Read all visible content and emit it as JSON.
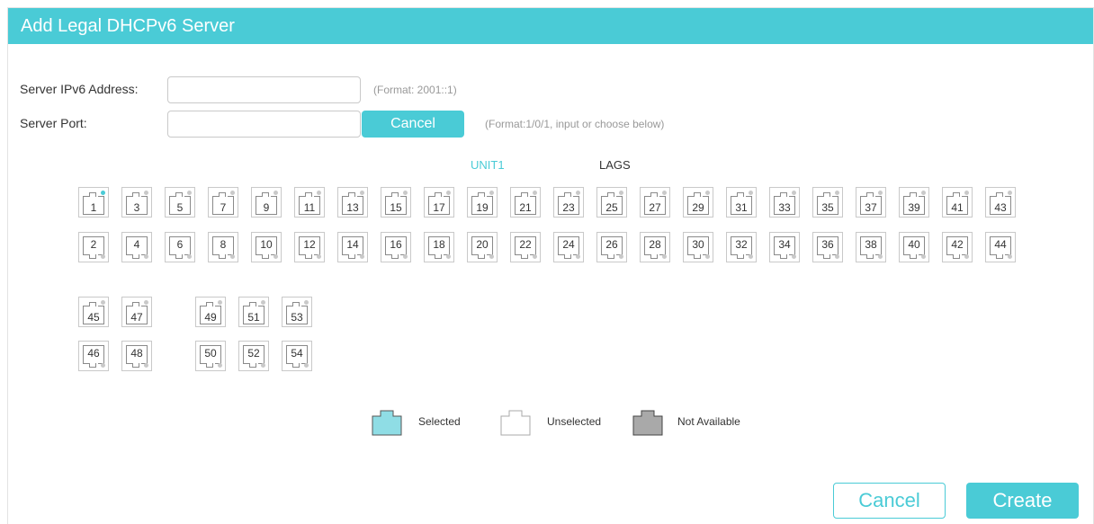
{
  "dialog": {
    "title": "Add Legal DHCPv6 Server"
  },
  "form": {
    "ipv6_label": "Server IPv6 Address:",
    "ipv6_value": "",
    "ipv6_hint": "(Format: 2001::1)",
    "port_label": "Server Port:",
    "port_value": "",
    "port_cancel_label": "Cancel",
    "port_hint": "(Format:1/0/1, input or choose below)"
  },
  "tabs": {
    "unit": "UNIT1",
    "lags": "LAGS"
  },
  "ports": {
    "row1": [
      "1",
      "3",
      "5",
      "7",
      "9",
      "11",
      "13",
      "15",
      "17",
      "19",
      "21",
      "23",
      "25",
      "27",
      "29",
      "31",
      "33",
      "35",
      "37",
      "39",
      "41",
      "43"
    ],
    "row2": [
      "2",
      "4",
      "6",
      "8",
      "10",
      "12",
      "14",
      "16",
      "18",
      "20",
      "22",
      "24",
      "26",
      "28",
      "30",
      "32",
      "34",
      "36",
      "38",
      "40",
      "42",
      "44"
    ],
    "group2_top": [
      "45",
      "47"
    ],
    "group2_bottom": [
      "46",
      "48"
    ],
    "group3_top": [
      "49",
      "51",
      "53"
    ],
    "group3_bottom": [
      "50",
      "52",
      "54"
    ],
    "active_led_port": "1"
  },
  "legend": {
    "selected": "Selected",
    "unselected": "Unselected",
    "not_available": "Not Available"
  },
  "colors": {
    "accent": "#4acbd6",
    "selected_fill": "#8fdde5",
    "not_available_fill": "#a9a9a9"
  },
  "footer": {
    "cancel_label": "Cancel",
    "create_label": "Create"
  }
}
